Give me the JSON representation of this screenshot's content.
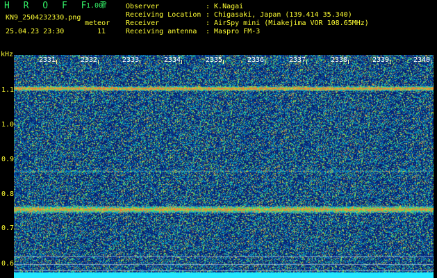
{
  "header": {
    "logo": "H R O F F T",
    "version": "1.00f",
    "filename": "KN9_2504232330.png",
    "meteor_label": "meteor",
    "datetime": "25.04.23 23:30",
    "count": "11"
  },
  "meta": [
    {
      "key": "Observer",
      "value": ": K.Nagai"
    },
    {
      "key": "Receiving Location",
      "value": ": Chigasaki, Japan (139.414 35.340)"
    },
    {
      "key": "Receiver",
      "value": ": AirSpy mini (Miakejima VOR 108.65MHz)"
    },
    {
      "key": "Receiving antenna",
      "value": ": Maspro FM-3"
    }
  ],
  "axis": {
    "y_unit": "kHz",
    "y_labels": [
      "1.1",
      "1.0",
      "0.9",
      "0.8",
      "0.7",
      "0.6"
    ],
    "x_labels": [
      "2331",
      "2332",
      "2333",
      "2334",
      "2335",
      "2336",
      "2337",
      "2338",
      "2339",
      "2340"
    ]
  },
  "colors": {
    "background": "#061a6a",
    "text": "#ffff33",
    "logo": "#33ee66"
  }
}
